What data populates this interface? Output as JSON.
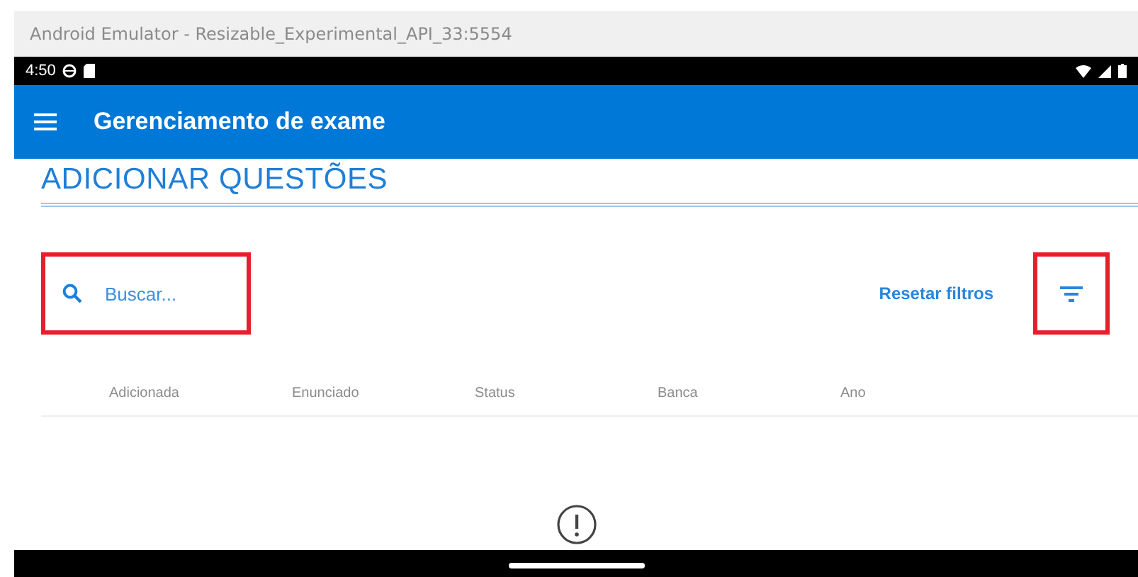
{
  "window": {
    "title": "Android Emulator - Resizable_Experimental_API_33:5554"
  },
  "status_bar": {
    "time": "4:50"
  },
  "app_bar": {
    "title": "Gerenciamento de exame"
  },
  "page": {
    "heading": "ADICIONAR QUESTÕES"
  },
  "search": {
    "placeholder": "Buscar...",
    "highlighted": true
  },
  "reset_filters": {
    "label": "Resetar filtros"
  },
  "filter_button": {
    "highlighted": true
  },
  "table": {
    "columns": [
      "Adicionada",
      "Enunciado",
      "Status",
      "Banca",
      "Ano"
    ]
  }
}
